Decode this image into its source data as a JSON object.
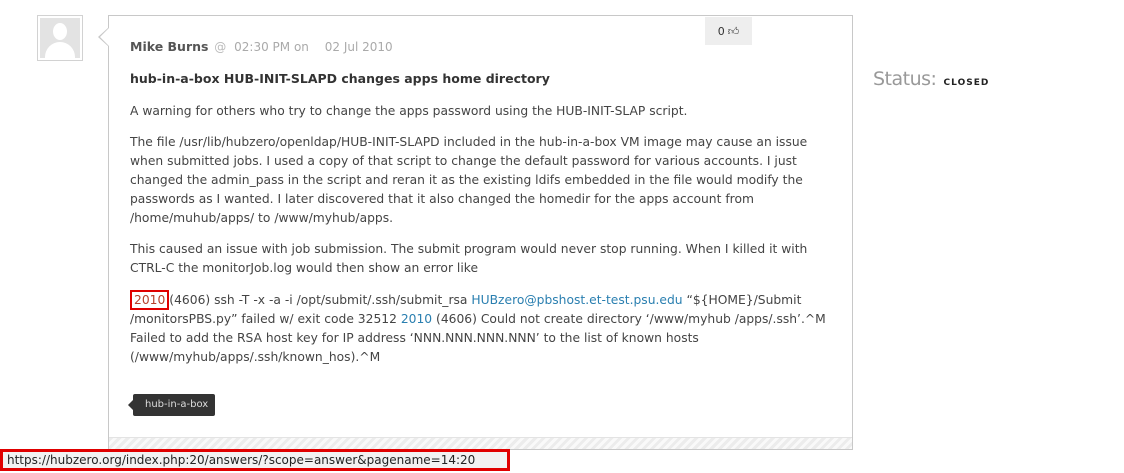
{
  "post": {
    "author": "Mike Burns",
    "at_symbol": "@",
    "time": "02:30 PM",
    "on_word": "on",
    "date": "02 Jul 2010",
    "vote_count": "0",
    "title": "hub-in-a-box HUB-INIT-SLAPD changes apps home directory",
    "paragraphs": [
      "A warning for others who try to change the apps password using the HUB-INIT-SLAP script.",
      "The file /usr/lib/hubzero/openldap/HUB-INIT-SLAPD included in the hub-in-a-box VM image may cause an issue when submitted jobs. I used a copy of that script to change the default password for various accounts. I just changed the admin_pass in the script and reran it as the existing ldifs embedded in the file would modify the passwords as I wanted. I later discovered that it also changed the homedir for the apps account from /home/muhub/apps/ to /www/myhub/apps.",
      "This caused an issue with job submission. The submit program would never stop running. When I killed it with CTRL-C the monitorJob.log would then show an error like"
    ],
    "log": {
      "year1": "2010",
      "part1": "(4606) ssh -T -x -a -i /opt/submit/.ssh/submit_rsa ",
      "email": "HUBzero@pbshost.et-test.psu.edu",
      "part2": " “${HOME}/Submit /monitorsPBS.py” failed w/ exit code 32512 ",
      "year2": "2010",
      "part3": " (4606) Could not create directory ‘/www/myhub /apps/.ssh’.^M Failed to add the RSA host key for IP address ‘NNN.NNN.NNN.NNN’ to the list of known hosts (/www/myhub/apps/.ssh/known_hos).^M"
    },
    "tag": "hub-in-a-box"
  },
  "status": {
    "label": "Status:",
    "value": "CLOSED"
  },
  "statusbar": {
    "url": "https://hubzero.org/index.php:20/answers/?scope=answer&pagename=14:20"
  },
  "icons": {
    "avatar": "user-silhouette-icon",
    "vote": "thumbs-up-icon"
  },
  "colors": {
    "link": "#2a7fb0",
    "highlight_border": "#e00000",
    "tag_bg": "#333333"
  }
}
